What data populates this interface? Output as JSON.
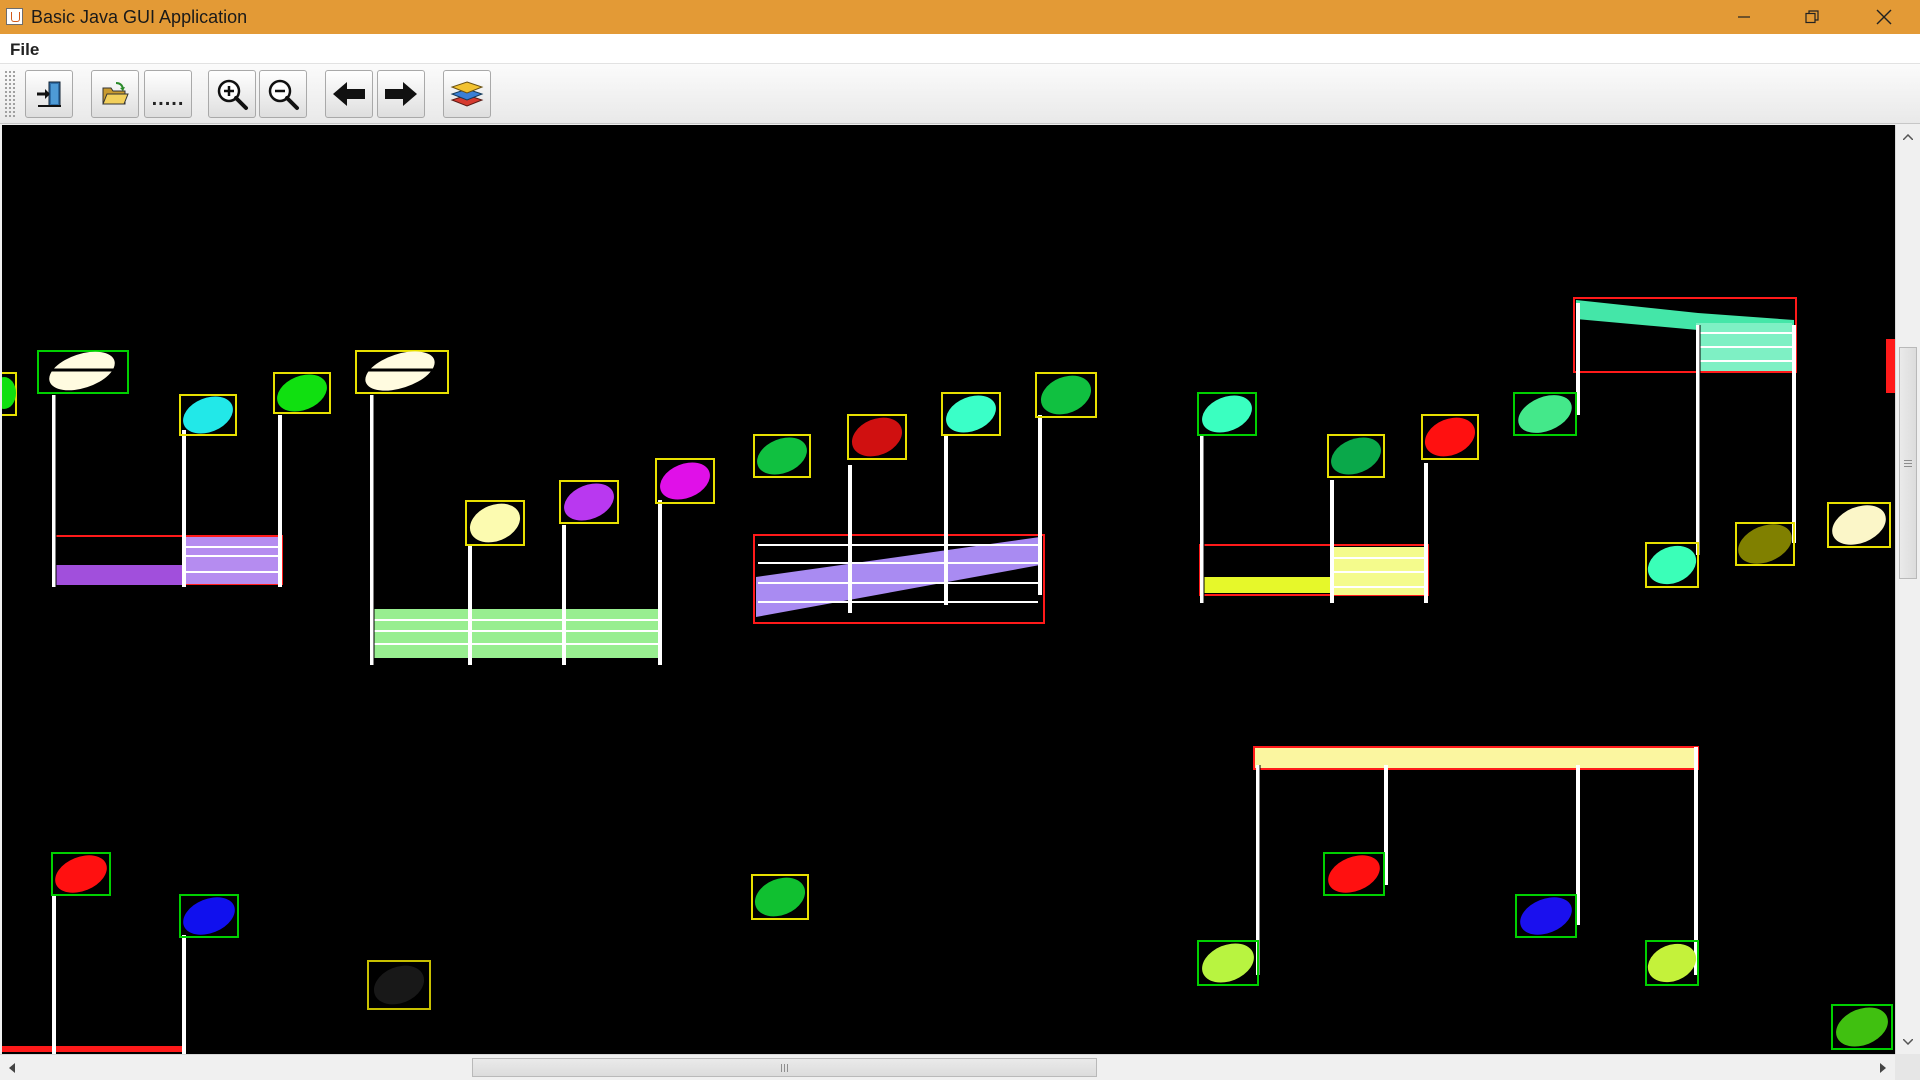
{
  "window": {
    "title": "Basic Java GUI Application",
    "controls": [
      "minimize",
      "restore",
      "close"
    ]
  },
  "menubar": {
    "items": [
      {
        "label": "File"
      }
    ]
  },
  "toolbar": {
    "buttons": [
      {
        "name": "exit-button",
        "icon": "exit-door-icon"
      },
      {
        "name": "open-button",
        "icon": "open-folder-icon"
      },
      {
        "name": "more-button",
        "icon": "ellipsis-icon",
        "label": "....."
      },
      {
        "name": "zoom-in-button",
        "icon": "zoom-in-icon"
      },
      {
        "name": "zoom-out-button",
        "icon": "zoom-out-icon"
      },
      {
        "name": "back-button",
        "icon": "arrow-left-icon"
      },
      {
        "name": "forward-button",
        "icon": "arrow-right-icon"
      },
      {
        "name": "layers-button",
        "icon": "layers-icon"
      }
    ]
  },
  "canvas": {
    "background": "#000000",
    "annotation_colors": {
      "note_box_green": "#00d000",
      "note_box_yellow": "#e8e000",
      "beam_box_red": "#ff1a1a",
      "stem": "#ffffff"
    }
  },
  "scrollbars": {
    "vertical": {
      "position_fraction": 0.24,
      "visible_fraction": 0.27
    },
    "horizontal": {
      "position_fraction": 0.25,
      "visible_fraction": 0.33
    }
  }
}
